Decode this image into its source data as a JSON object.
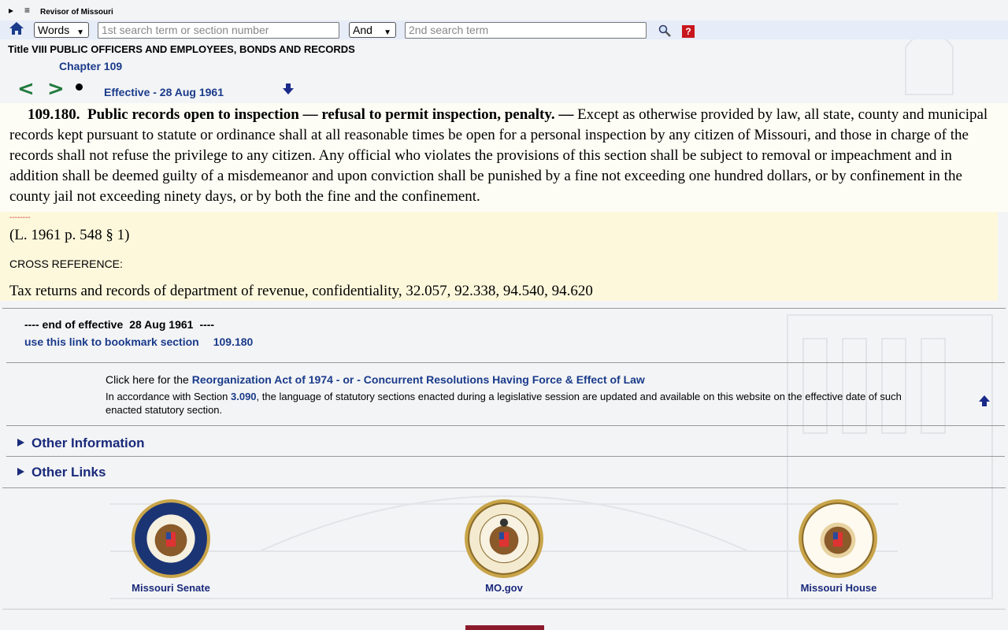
{
  "topbar": {
    "site_name": "Revisor of Missouri"
  },
  "search": {
    "mode_selected": "Words",
    "term1_placeholder": "1st search term or section number",
    "operator_selected": "And",
    "term2_placeholder": "2nd search term",
    "help_label": "?"
  },
  "header": {
    "title": "Title VIII PUBLIC OFFICERS AND EMPLOYEES, BONDS AND RECORDS",
    "chapter": "Chapter 109"
  },
  "nav": {
    "prev": "<",
    "next": ">",
    "effective": "Effective - 28 Aug 1961"
  },
  "section": {
    "number": "109.180.",
    "heading": "Public records open to inspection — refusal to permit inspection, penalty. —",
    "body": "Except as otherwise provided by law, all state, county and municipal records kept pursuant to statute or ordinance shall at all reasonable times be open for a personal inspection by any citizen of Missouri, and those in charge of the records shall not refuse the privilege to any citizen.  Any official who violates the provisions of this section shall be subject to removal or impeachment and in addition shall be deemed guilty of a misdemeanor and upon conviction shall be punished by a fine not exceeding one hundred dollars, or by confinement in the county jail not exceeding ninety days, or by both the fine and the confinement."
  },
  "history": {
    "dashes": "--------",
    "citation": "(L. 1961 p. 548 § 1)",
    "cross_ref_label": "CROSS REFERENCE:",
    "cross_ref_text": "Tax returns and records of department of revenue, confidentiality, 32.057, 92.338, 94.540, 94.620"
  },
  "footer_info": {
    "end_prefix": "---- end of effective",
    "end_date": "28 Aug 1961",
    "end_suffix": "----",
    "bookmark_text": "use this link to bookmark section",
    "bookmark_section": "109.180",
    "reorg_prefix": "Click here for the",
    "reorg_link": "Reorganization Act of 1974 - or - Concurrent Resolutions Having Force & Effect of Law",
    "accord_prefix": "In accordance with Section",
    "accord_link": "3.090",
    "accord_suffix": ", the language of statutory sections enacted during a legislative session are updated and available on this website on the effective date of such enacted statutory section."
  },
  "disclosures": {
    "other_information": "Other Information",
    "other_links": "Other Links"
  },
  "seals": {
    "senate": "Missouri Senate",
    "mogov": "MO.gov",
    "house": "Missouri House",
    "senate_seal_text": "MISSOURI SENATE",
    "state_seal_text": "THE GREAT SEAL OF THE STATE OF MISSOURI",
    "house_seal_text": "MISSOURI HOUSE OF REPRESENTATIVES"
  },
  "colors": {
    "link": "#1a3b8a",
    "nav_arrow": "#217a3d",
    "history_bg": "#fdf8dc",
    "help_red": "#c8171e"
  }
}
